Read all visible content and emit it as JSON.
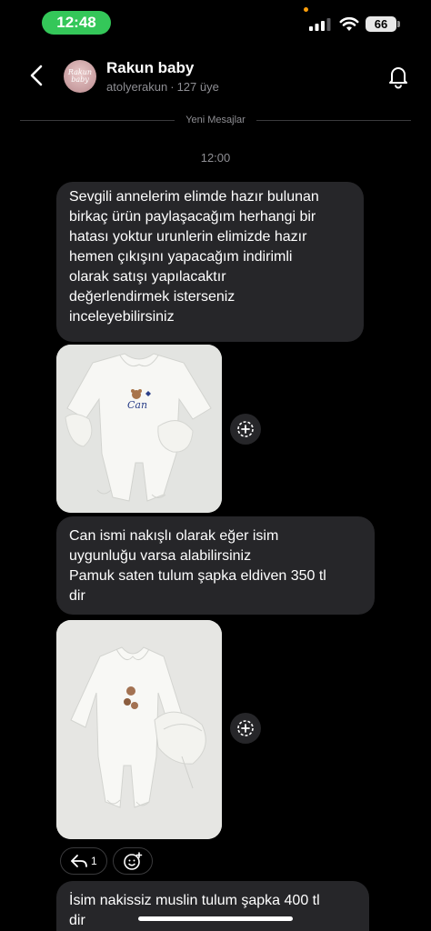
{
  "status_bar": {
    "time": "12:48",
    "battery": "66",
    "colors": {
      "time_pill": "#34c759",
      "privacy_dot": "#ff9f0a"
    }
  },
  "header": {
    "avatar_text": "Rakun baby",
    "title": "Rakun baby",
    "username": "atolyerakun",
    "separator": "·",
    "members": "127 üye",
    "icons": {
      "back": "chevron-left-icon",
      "notifications": "bell-icon"
    }
  },
  "divider": {
    "label": "Yeni Mesajlar"
  },
  "timestamp": "12:00",
  "messages": [
    {
      "type": "text",
      "text": "Sevgili annelerim elimde hazır bulunan\nbirkaç ürün paylaşacağım herhangi bir\nhatası yoktur urunlerin elimizde hazır\nhemen çıkışını yapacağım indirimli\nolarak satışı yapılacaktır\ndeğerlendirmek isterseniz\ninceleyebilirsiniz"
    },
    {
      "type": "image",
      "embroidery": "Can",
      "icon": "save-plus-icon"
    },
    {
      "type": "text",
      "text": "Can ismi nakışlı olarak eğer isim\nuygunluğu varsa alabilirsiniz\nPamuk saten tulum şapka eldiven 350 tl\ndir"
    },
    {
      "type": "image",
      "icon": "save-plus-icon"
    },
    {
      "type": "text",
      "text": "İsim nakissiz muslin tulum şapka 400 tl\ndir"
    }
  ],
  "reactions": {
    "reply_count": "1",
    "icons": {
      "reply": "reply-arrow-icon",
      "add_reaction": "add-emoji-icon"
    }
  },
  "theme": {
    "background": "#000000",
    "bubble": "#262629",
    "muted_text": "#8e8e93"
  }
}
